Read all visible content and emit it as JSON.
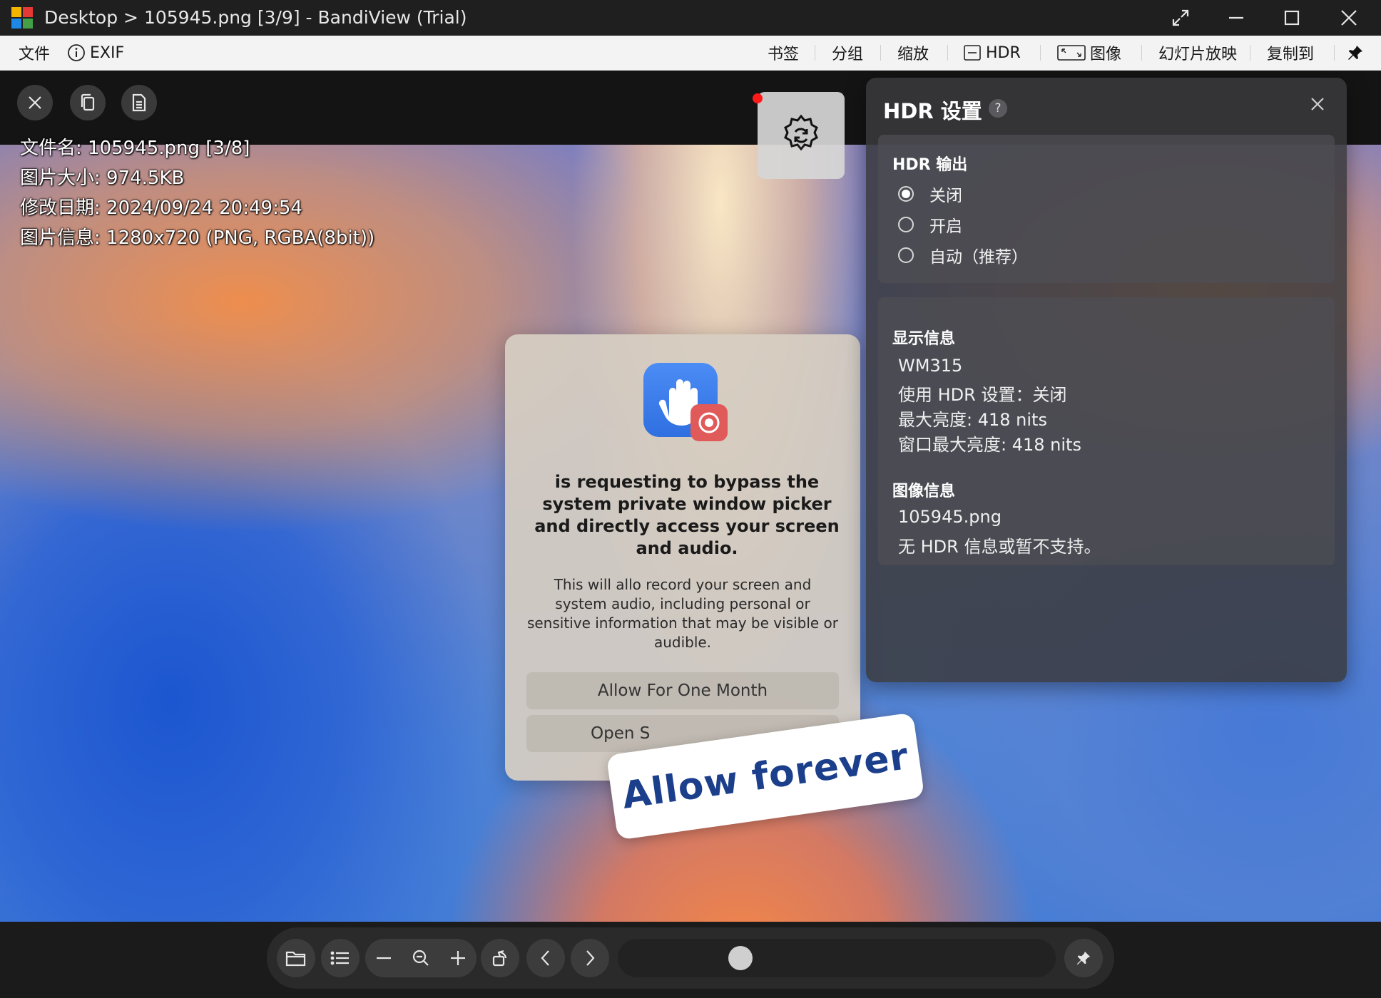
{
  "window": {
    "title": "Desktop > 105945.png [3/9] - BandiView (Trial)"
  },
  "menubar": {
    "file": "文件",
    "exif": "EXIF",
    "bookmark": "书签",
    "group": "分组",
    "zoom": "缩放",
    "hdr": "HDR",
    "image": "图像",
    "slideshow": "幻灯片放映",
    "copy_to": "复制到"
  },
  "overlay_info": {
    "filename": "文件名: 105945.png [3/8]",
    "size": "图片大小: 974.5KB",
    "modified": "修改日期: 2024/09/24 20:49:54",
    "info": "图片信息: 1280x720 (PNG, RGBA(8bit))"
  },
  "image_content": {
    "dialog_title": "is requesting to bypass the system private window picker and directly access your screen and audio.",
    "dialog_body": "This will allo      record your screen and system audio, including personal or sensitive information that may be visible or audible.",
    "button_allow_month": "Allow For One Month",
    "button_open": "Open S",
    "sticker_text": "Allow forever"
  },
  "hdr_panel": {
    "title": "HDR 设置",
    "help": "?",
    "output_heading": "HDR 输出",
    "options": [
      "关闭",
      "开启",
      "自动（推荐）"
    ],
    "selected_index": 0,
    "display_heading": "显示信息",
    "display_lines": [
      "WM315",
      "使用 HDR 设置：关闭",
      "最大亮度: 418 nits",
      "窗口最大亮度: 418 nits"
    ],
    "image_heading": "图像信息",
    "image_lines": [
      "105945.png",
      "无 HDR 信息或暂不支持。"
    ]
  },
  "slider": {
    "position_fraction": 0.25
  }
}
